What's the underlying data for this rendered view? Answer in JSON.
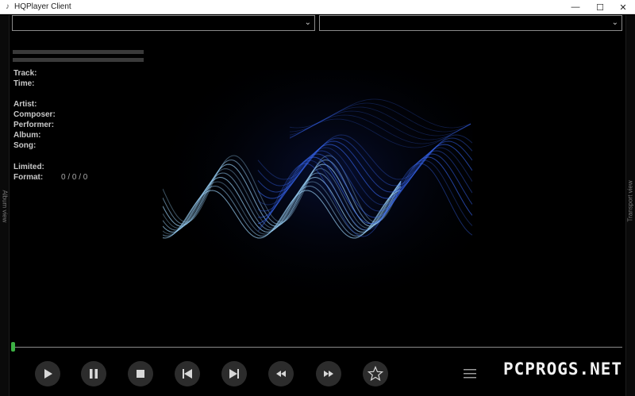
{
  "window": {
    "title": "HQPlayer Client",
    "minimize": "—",
    "maximize": "☐",
    "close": "✕"
  },
  "edges": {
    "left_label": "Album view",
    "right_label": "Transport view"
  },
  "selectors": {
    "left_value": "",
    "right_value": ""
  },
  "info": {
    "track_label": "Track:",
    "time_label": "Time:",
    "artist_label": "Artist:",
    "composer_label": "Composer:",
    "performer_label": "Performer:",
    "album_label": "Album:",
    "song_label": "Song:",
    "limited_label": "Limited:",
    "format_label": "Format:",
    "format_value": "0 / 0 / 0"
  },
  "seek": {
    "position": 0.0
  },
  "transport": {
    "icons": [
      "play-icon",
      "pause-icon",
      "stop-icon",
      "previous-icon",
      "next-icon",
      "rewind-icon",
      "fast-forward-icon",
      "star-icon",
      "menu-icon"
    ]
  },
  "watermark": "PCPROGS.NET",
  "colors": {
    "background": "#000000",
    "button": "#2c2c2c",
    "seek_handle": "#3cb043",
    "viz_blue": "#3a6cff",
    "viz_cyan": "#9fd8ff"
  }
}
